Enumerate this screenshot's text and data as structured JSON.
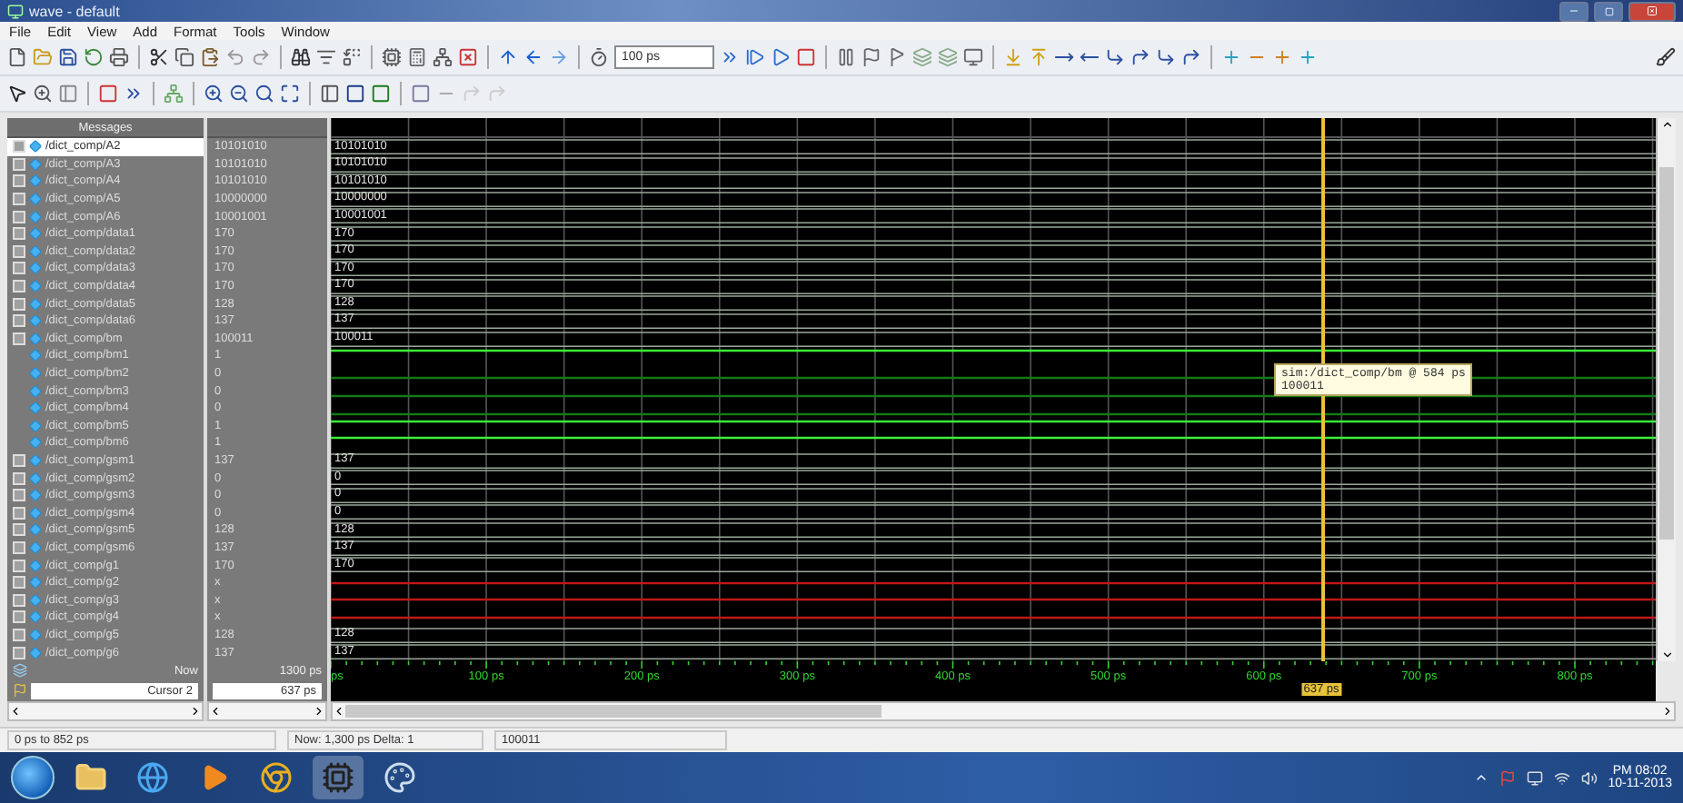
{
  "window": {
    "title": "wave - default"
  },
  "menu": [
    "File",
    "Edit",
    "View",
    "Add",
    "Format",
    "Tools",
    "Window"
  ],
  "toolbar": {
    "zoom_value": "100 ps"
  },
  "wave": {
    "header": "Messages",
    "signals": [
      {
        "name": "/dict_comp/A2",
        "value": "10101010",
        "kind": "bus",
        "wave_label": "10101010",
        "selected": true
      },
      {
        "name": "/dict_comp/A3",
        "value": "10101010",
        "kind": "bus",
        "wave_label": "10101010",
        "selected": false
      },
      {
        "name": "/dict_comp/A4",
        "value": "10101010",
        "kind": "bus",
        "wave_label": "10101010",
        "selected": false
      },
      {
        "name": "/dict_comp/A5",
        "value": "10000000",
        "kind": "bus",
        "wave_label": "10000000",
        "selected": false
      },
      {
        "name": "/dict_comp/A6",
        "value": "10001001",
        "kind": "bus",
        "wave_label": "10001001",
        "selected": false
      },
      {
        "name": "/dict_comp/data1",
        "value": "170",
        "kind": "bus",
        "wave_label": "170",
        "selected": false
      },
      {
        "name": "/dict_comp/data2",
        "value": "170",
        "kind": "bus",
        "wave_label": "170",
        "selected": false
      },
      {
        "name": "/dict_comp/data3",
        "value": "170",
        "kind": "bus",
        "wave_label": "170",
        "selected": false
      },
      {
        "name": "/dict_comp/data4",
        "value": "170",
        "kind": "bus",
        "wave_label": "170",
        "selected": false
      },
      {
        "name": "/dict_comp/data5",
        "value": "128",
        "kind": "bus",
        "wave_label": "128",
        "selected": false
      },
      {
        "name": "/dict_comp/data6",
        "value": "137",
        "kind": "bus",
        "wave_label": "137",
        "selected": false
      },
      {
        "name": "/dict_comp/bm",
        "value": "100011",
        "kind": "bus",
        "wave_label": "100011",
        "selected": false
      },
      {
        "name": "/dict_comp/bm1",
        "value": "1",
        "kind": "bit",
        "high": true,
        "selected": false
      },
      {
        "name": "/dict_comp/bm2",
        "value": "0",
        "kind": "bit",
        "high": false,
        "selected": false
      },
      {
        "name": "/dict_comp/bm3",
        "value": "0",
        "kind": "bit",
        "high": false,
        "selected": false
      },
      {
        "name": "/dict_comp/bm4",
        "value": "0",
        "kind": "bit",
        "high": false,
        "selected": false
      },
      {
        "name": "/dict_comp/bm5",
        "value": "1",
        "kind": "bit",
        "high": true,
        "selected": false
      },
      {
        "name": "/dict_comp/bm6",
        "value": "1",
        "kind": "bit",
        "high": true,
        "selected": false
      },
      {
        "name": "/dict_comp/gsm1",
        "value": "137",
        "kind": "bus",
        "wave_label": "137",
        "selected": false
      },
      {
        "name": "/dict_comp/gsm2",
        "value": "0",
        "kind": "bus",
        "wave_label": "0",
        "selected": false
      },
      {
        "name": "/dict_comp/gsm3",
        "value": "0",
        "kind": "bus",
        "wave_label": "0",
        "selected": false
      },
      {
        "name": "/dict_comp/gsm4",
        "value": "0",
        "kind": "bus",
        "wave_label": "0",
        "selected": false
      },
      {
        "name": "/dict_comp/gsm5",
        "value": "128",
        "kind": "bus",
        "wave_label": "128",
        "selected": false
      },
      {
        "name": "/dict_comp/gsm6",
        "value": "137",
        "kind": "bus",
        "wave_label": "137",
        "selected": false
      },
      {
        "name": "/dict_comp/g1",
        "value": "170",
        "kind": "bus",
        "wave_label": "170",
        "selected": false
      },
      {
        "name": "/dict_comp/g2",
        "value": "x",
        "kind": "unknown",
        "selected": false
      },
      {
        "name": "/dict_comp/g3",
        "value": "x",
        "kind": "unknown",
        "selected": false
      },
      {
        "name": "/dict_comp/g4",
        "value": "x",
        "kind": "unknown",
        "selected": false
      },
      {
        "name": "/dict_comp/g5",
        "value": "128",
        "kind": "bus",
        "wave_label": "128",
        "selected": false
      },
      {
        "name": "/dict_comp/g6",
        "value": "137",
        "kind": "bus",
        "wave_label": "137",
        "selected": false
      }
    ],
    "now": {
      "label": "Now",
      "value": "1300 ps"
    },
    "cursor": {
      "label": "Cursor 2",
      "value": "637 ps",
      "time_label": "637 ps"
    },
    "axis_labels": [
      "ps",
      "100 ps",
      "200 ps",
      "300 ps",
      "400 ps",
      "500 ps",
      "600 ps",
      "700 ps",
      "800 ps"
    ],
    "tooltip": [
      "sim:/dict_comp/bm @ 584 ps",
      "100011"
    ]
  },
  "status_bar": [
    "0 ps to 852 ps",
    "Now: 1,300 ps  Delta: 1",
    "100011"
  ],
  "taskbar": {
    "time": "PM 08:02",
    "date": "10-11-2013"
  }
}
